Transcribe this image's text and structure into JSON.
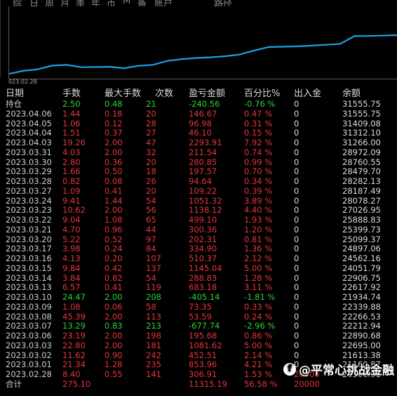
{
  "top_tabs": [
    "综",
    "日",
    "周",
    "月",
    "季",
    "年",
    "币",
    "M",
    "备",
    "账户",
    "路径"
  ],
  "chart": {
    "start_label": "023.02.28",
    "line_color": "#1aa3e8"
  },
  "table": {
    "headers": [
      "日期",
      "手数",
      "最大手数",
      "次数",
      "盈亏金额",
      "百分比%",
      "出入金",
      "余额"
    ],
    "position_row": {
      "date": "持仓",
      "lots": "2.50",
      "max_lots": "0.48",
      "count": "21",
      "pnl": "-240.56",
      "pct": "-0.76 %",
      "flow": "0",
      "balance": "31555.75"
    },
    "rows": [
      {
        "date": "2023.04.06",
        "lots": "1.44",
        "max_lots": "0.18",
        "count": "20",
        "pnl": "146.67",
        "pct": "0.47 %",
        "flow": "0",
        "balance": "31555.75"
      },
      {
        "date": "2023.04.05",
        "lots": "1.06",
        "max_lots": "0.12",
        "count": "28",
        "pnl": "96.98",
        "pct": "0.31 %",
        "flow": "0",
        "balance": "31409.08"
      },
      {
        "date": "2023.04.04",
        "lots": "1.51",
        "max_lots": "0.37",
        "count": "27",
        "pnl": "46.10",
        "pct": "0.15 %",
        "flow": "0",
        "balance": "31312.10"
      },
      {
        "date": "2023.04.03",
        "lots": "19.26",
        "max_lots": "2.00",
        "count": "47",
        "pnl": "2293.91",
        "pct": "7.92 %",
        "flow": "0",
        "balance": "31266.00"
      },
      {
        "date": "2023.03.31",
        "lots": "4.03",
        "max_lots": "2.00",
        "count": "32",
        "pnl": "211.54",
        "pct": "0.74 %",
        "flow": "0",
        "balance": "28972.09"
      },
      {
        "date": "2023.03.30",
        "lots": "2.80",
        "max_lots": "0.36",
        "count": "20",
        "pnl": "280.85",
        "pct": "0.99 %",
        "flow": "0",
        "balance": "28760.55"
      },
      {
        "date": "2023.03.29",
        "lots": "1.66",
        "max_lots": "0.50",
        "count": "18",
        "pnl": "197.57",
        "pct": "0.70 %",
        "flow": "0",
        "balance": "28479.70"
      },
      {
        "date": "2023.03.28",
        "lots": "0.82",
        "max_lots": "0.08",
        "count": "26",
        "pnl": "94.64",
        "pct": "0.34 %",
        "flow": "0",
        "balance": "28282.13"
      },
      {
        "date": "2023.03.27",
        "lots": "1.09",
        "max_lots": "0.41",
        "count": "20",
        "pnl": "109.22",
        "pct": "0.39 %",
        "flow": "0",
        "balance": "28187.49"
      },
      {
        "date": "2023.03.24",
        "lots": "9.41",
        "max_lots": "1.44",
        "count": "54",
        "pnl": "1051.32",
        "pct": "3.89 %",
        "flow": "0",
        "balance": "28078.27"
      },
      {
        "date": "2023.03.23",
        "lots": "10.62",
        "max_lots": "2.00",
        "count": "56",
        "pnl": "1138.12",
        "pct": "4.40 %",
        "flow": "0",
        "balance": "27026.95"
      },
      {
        "date": "2023.03.22",
        "lots": "9.04",
        "max_lots": "1.08",
        "count": "65",
        "pnl": "499.10",
        "pct": "1.93 %",
        "flow": "0",
        "balance": "25888.83"
      },
      {
        "date": "2023.03.21",
        "lots": "4.70",
        "max_lots": "0.96",
        "count": "44",
        "pnl": "300.36",
        "pct": "1.20 %",
        "flow": "0",
        "balance": "25399.73"
      },
      {
        "date": "2023.03.20",
        "lots": "5.22",
        "max_lots": "0.52",
        "count": "97",
        "pnl": "202.31",
        "pct": "0.81 %",
        "flow": "0",
        "balance": "25099.37"
      },
      {
        "date": "2023.03.17",
        "lots": "3.98",
        "max_lots": "0.24",
        "count": "84",
        "pnl": "334.90",
        "pct": "1.36 %",
        "flow": "0",
        "balance": "24897.06"
      },
      {
        "date": "2023.03.16",
        "lots": "4.13",
        "max_lots": "0.20",
        "count": "107",
        "pnl": "510.37",
        "pct": "2.12 %",
        "flow": "0",
        "balance": "24562.16"
      },
      {
        "date": "2023.03.15",
        "lots": "9.84",
        "max_lots": "0.42",
        "count": "137",
        "pnl": "1145.04",
        "pct": "5.00 %",
        "flow": "0",
        "balance": "24051.79"
      },
      {
        "date": "2023.03.14",
        "lots": "3.84",
        "max_lots": "0.82",
        "count": "54",
        "pnl": "288.83",
        "pct": "1.28 %",
        "flow": "0",
        "balance": "22906.75"
      },
      {
        "date": "2023.03.13",
        "lots": "6.57",
        "max_lots": "0.41",
        "count": "119",
        "pnl": "683.18",
        "pct": "3.11 %",
        "flow": "0",
        "balance": "22617.92"
      },
      {
        "date": "2023.03.10",
        "lots": "24.47",
        "max_lots": "2.00",
        "count": "208",
        "pnl": "-405.14",
        "pct": "-1.81 %",
        "flow": "0",
        "balance": "21934.74"
      },
      {
        "date": "2023.03.09",
        "lots": "1.08",
        "max_lots": "0.06",
        "count": "58",
        "pnl": "73.35",
        "pct": "0.33 %",
        "flow": "0",
        "balance": "22339.88"
      },
      {
        "date": "2023.03.08",
        "lots": "45.39",
        "max_lots": "2.00",
        "count": "113",
        "pnl": "53.59",
        "pct": "0.24 %",
        "flow": "0",
        "balance": "22266.53"
      },
      {
        "date": "2023.03.07",
        "lots": "13.29",
        "max_lots": "0.83",
        "count": "213",
        "pnl": "-677.74",
        "pct": "-2.96 %",
        "flow": "0",
        "balance": "22212.94"
      },
      {
        "date": "2023.03.06",
        "lots": "23.19",
        "max_lots": "2.00",
        "count": "198",
        "pnl": "195.68",
        "pct": "0.86 %",
        "flow": "0",
        "balance": "22890.68"
      },
      {
        "date": "2023.03.03",
        "lots": "22.80",
        "max_lots": "2.00",
        "count": "181",
        "pnl": "1081.62",
        "pct": "5.00 %",
        "flow": "0",
        "balance": "22695.00"
      },
      {
        "date": "2023.03.02",
        "lots": "11.62",
        "max_lots": "0.90",
        "count": "242",
        "pnl": "452.51",
        "pct": "2.14 %",
        "flow": "0",
        "balance": "21613.38"
      },
      {
        "date": "2023.03.01",
        "lots": "21.34",
        "max_lots": "1.28",
        "count": "235",
        "pnl": "853.96",
        "pct": "4.21 %",
        "flow": "0",
        "balance": "21160.87"
      },
      {
        "date": "2023.02.28",
        "lots": "8.40",
        "max_lots": "0.55",
        "count": "141",
        "pnl": "306.91",
        "pct": "1.53 %",
        "flow": "20000",
        "balance": "20306.91"
      }
    ],
    "total_row": {
      "date": "合计",
      "lots": "275.10",
      "pnl": "11315.19",
      "pct": "56.58 %",
      "flow": "20000"
    }
  },
  "watermark": {
    "icon": "facebook-icon",
    "icon_glyph": "f",
    "text": "@平常心挑战金融"
  },
  "colors": {
    "profit": "#e8343a",
    "loss": "#2fd233",
    "position": "#2fd233",
    "line": "#1aa3e8"
  }
}
